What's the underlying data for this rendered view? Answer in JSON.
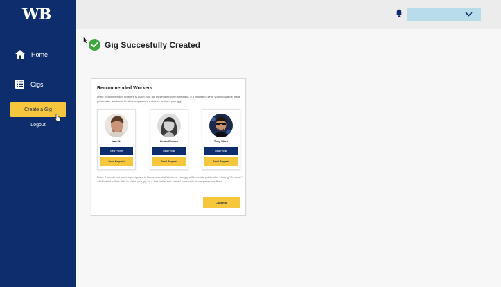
{
  "brand": {
    "logo_text": "WB"
  },
  "sidebar": {
    "items": [
      {
        "label": "Home",
        "icon": "home-icon"
      },
      {
        "label": "Gigs",
        "icon": "list-icon"
      }
    ],
    "create_button": "Create a Gig",
    "logout": "Logout"
  },
  "header": {
    "bell_icon": "bell-icon",
    "user_dropdown": {
      "value": "",
      "icon": "chevron-down-icon"
    }
  },
  "main": {
    "success_title": "Gig Succesfully Created",
    "success_icon": "check-circle-icon",
    "card": {
      "title": "Recommended Workers",
      "description": "Invite Recommended Workers to claim your gig by sending them a request. If a request is sent, your gig will be made public after two hours to allow requestees a chance to claim your gig.",
      "workers": [
        {
          "name": "Ivan N.",
          "view_label": "View Profile",
          "request_label": "Send Request"
        },
        {
          "name": "Linda Watson",
          "view_label": "View Profile",
          "request_label": "Send Request"
        },
        {
          "name": "Tony Stark",
          "view_label": "View Profile",
          "request_label": "Send Request"
        }
      ],
      "note": "Note: If you do not send any requests to Recommended Workers, your gig will be made public after clicking \"Continue\". All Workers will be able to claim your gig on a first come, first served basis until all vacancies are filled.",
      "continue_label": "Continue"
    }
  },
  "colors": {
    "sidebar_bg": "#0d2d6c",
    "accent_yellow": "#f6c63d",
    "success_green": "#3fa83f",
    "dropdown_bg": "#b8dcea"
  }
}
